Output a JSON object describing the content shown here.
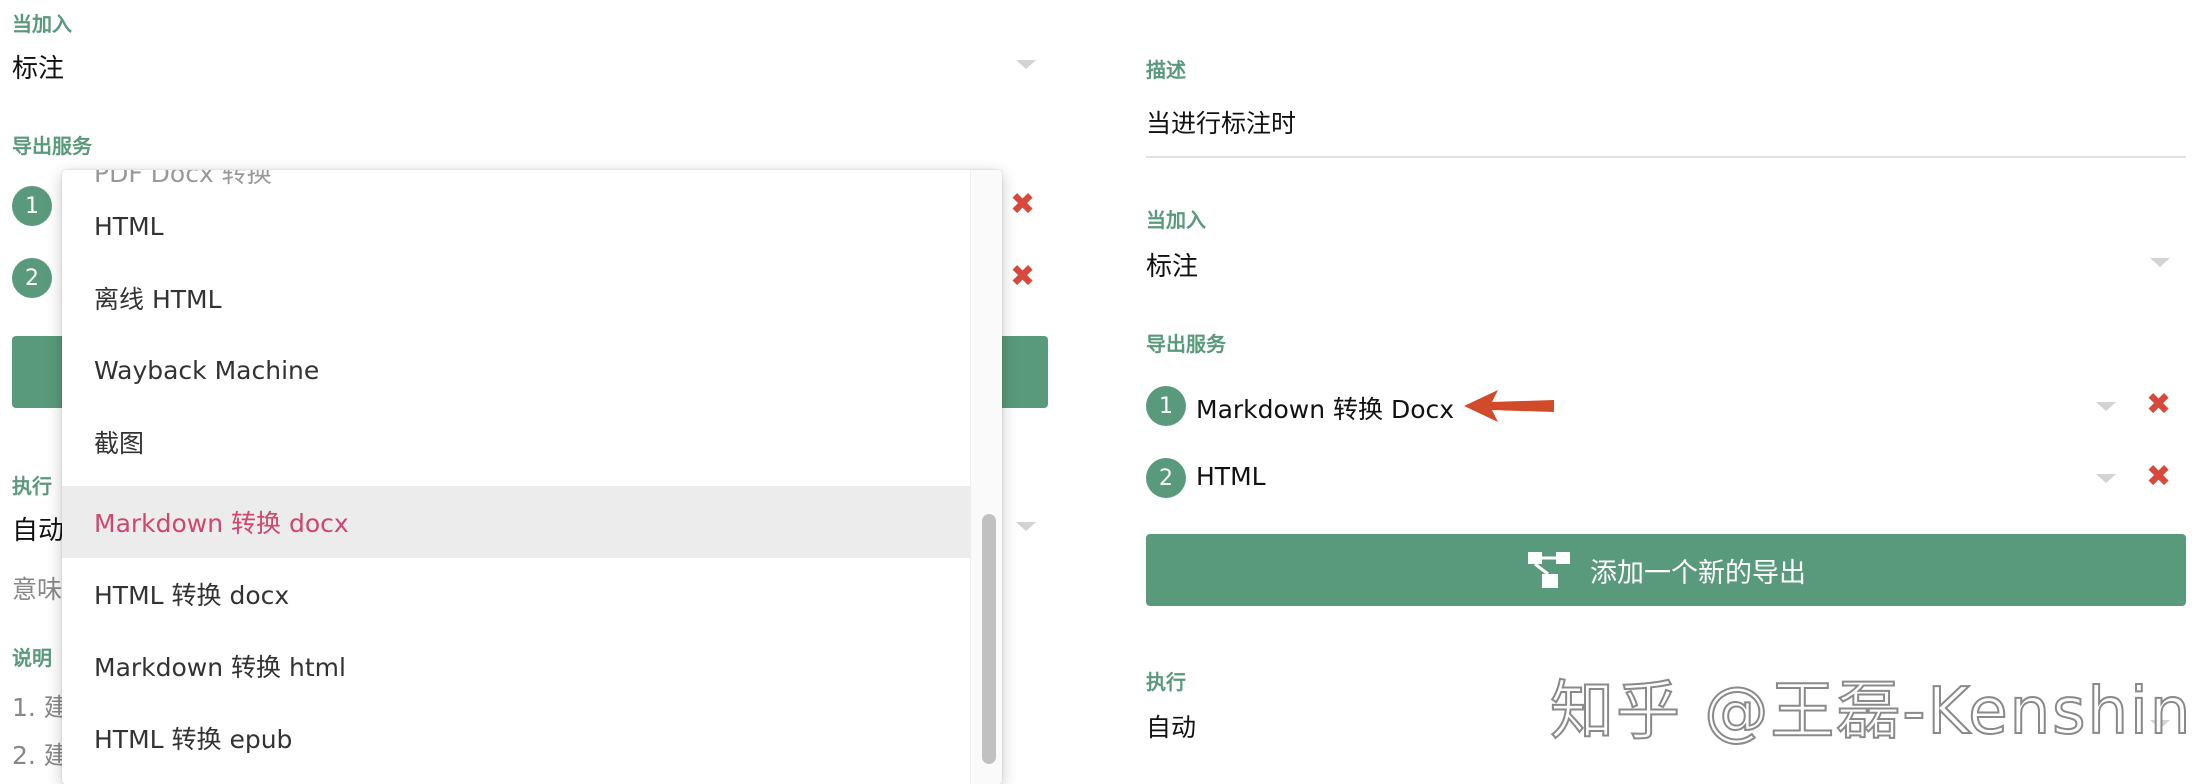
{
  "left_panel": {
    "trigger_label": "当加入",
    "trigger_value": "标注",
    "export_label": "导出服务",
    "export_items": [
      {
        "number": "1",
        "remove_icon": "close-icon"
      },
      {
        "number": "2",
        "remove_icon": "close-icon"
      }
    ],
    "execute_label": "执行",
    "execute_value": "自动",
    "execute_hint": "意味",
    "notes_label": "说明",
    "notes": [
      "1. 建",
      "2. 建"
    ]
  },
  "dropdown": {
    "partial_top": "PDF             Docx 转换",
    "items": [
      {
        "label": "HTML",
        "selected": false
      },
      {
        "label": "离线 HTML",
        "selected": false
      },
      {
        "label": "Wayback Machine",
        "selected": false
      },
      {
        "label": "截图",
        "selected": false
      },
      {
        "label": "Markdown 转换 docx",
        "selected": true
      },
      {
        "label": "HTML 转换 docx",
        "selected": false
      },
      {
        "label": "Markdown 转换 html",
        "selected": false
      },
      {
        "label": "HTML 转换 epub",
        "selected": false
      }
    ]
  },
  "right_panel": {
    "description_label": "描述",
    "description_value": "当进行标注时",
    "trigger_label": "当加入",
    "trigger_value": "标注",
    "export_label": "导出服务",
    "export_items": [
      {
        "number": "1",
        "label": "Markdown 转换 Docx"
      },
      {
        "number": "2",
        "label": "HTML"
      }
    ],
    "add_export_label": "添加一个新的导出",
    "add_export_icon": "flow-icon",
    "execute_label": "执行",
    "execute_value": "自动"
  },
  "watermark": "知乎 @王磊-Kenshin",
  "colors": {
    "accent_green": "#5a9a7c",
    "delete_red": "#d9483b",
    "selected_pink": "#d0466f",
    "arrow_orange": "#d14a2a"
  }
}
